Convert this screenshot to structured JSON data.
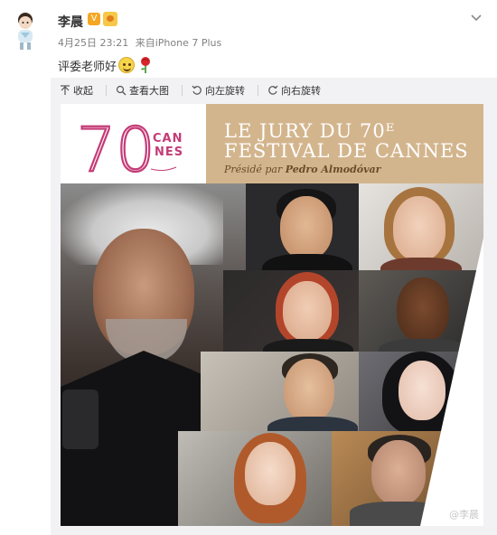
{
  "post": {
    "username": "李晨",
    "verified_badge": "V",
    "timestamp": "4月25日 23:21",
    "source_prefix": "来自",
    "source": "iPhone 7 Plus",
    "text": "评委老师好",
    "emoji": [
      "smile-emoji",
      "rose-emoji"
    ],
    "menu_icon": "chevron-down-icon"
  },
  "toolbar": {
    "collapse": "收起",
    "view_large": "查看大图",
    "rotate_left": "向左旋转",
    "rotate_right": "向右旋转"
  },
  "poster": {
    "logo_number": "70",
    "logo_word_1": "CAN",
    "logo_word_2": "NES",
    "title_line_1": "LE JURY DU 70ᴱ",
    "title_line_2": "FESTIVAL DE CANNES",
    "presided_prefix": "Présidé par",
    "president": "Pedro Almodóvar"
  },
  "watermark": "@李晨",
  "colors": {
    "page_bg": "#ffffff",
    "media_bg": "#f2f2f5",
    "poster_banner": "#d3b58d",
    "logo_pink": "#c43b77",
    "meta_text": "#808080"
  }
}
